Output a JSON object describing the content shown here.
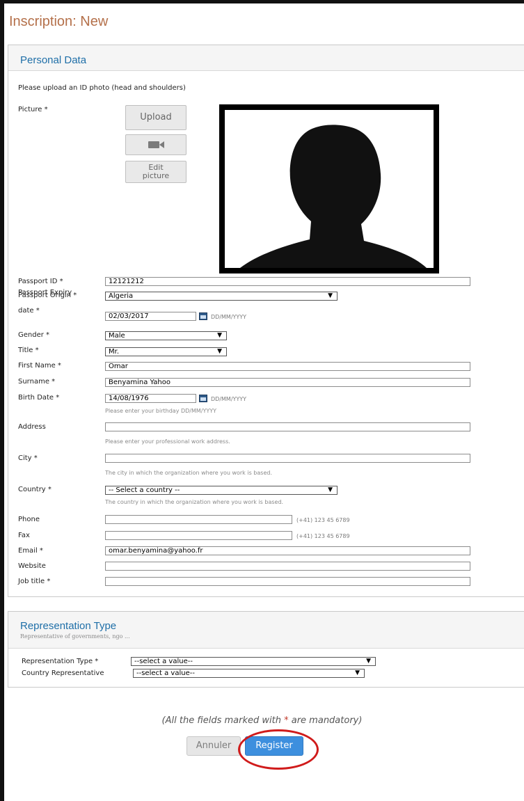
{
  "page": {
    "title": "Inscription: New"
  },
  "personal": {
    "section_title": "Personal Data",
    "photo_instruction": "Please upload an ID photo (head and shoulders)",
    "picture_label": "Picture *",
    "upload_label": "Upload",
    "edit_picture_label_1": "Edit",
    "edit_picture_label_2": "picture",
    "fields": {
      "passport_id": {
        "label": "Passport ID *",
        "value": "12121212"
      },
      "passport_origin": {
        "label": "Passport Origin *",
        "value": "Algeria"
      },
      "passport_expiry": {
        "label_1": "Passport Expiry",
        "label_2": "date *",
        "value": "02/03/2017",
        "format": "DD/MM/YYYY"
      },
      "gender": {
        "label": "Gender *",
        "value": "Male"
      },
      "title": {
        "label": "Title *",
        "value": "Mr."
      },
      "first_name": {
        "label": "First Name *",
        "value": "Omar"
      },
      "surname": {
        "label": "Surname *",
        "value": "Benyamina Yahoo"
      },
      "birth_date": {
        "label": "Birth Date *",
        "value": "14/08/1976",
        "format": "DD/MM/YYYY",
        "hint": "Please enter your birthday DD/MM/YYYY"
      },
      "address": {
        "label": "Address",
        "value": "",
        "hint": "Please enter your professional work address."
      },
      "city": {
        "label": "City *",
        "value": "",
        "hint": "The city in which the organization where you work is based."
      },
      "country": {
        "label": "Country *",
        "value": "-- Select a country --",
        "hint": "The country in which the organization where you work is based."
      },
      "phone": {
        "label": "Phone",
        "value": "",
        "example": "(+41) 123 45 6789"
      },
      "fax": {
        "label": "Fax",
        "value": "",
        "example": "(+41) 123 45 6789"
      },
      "email": {
        "label": "Email *",
        "value": "omar.benyamina@yahoo.fr"
      },
      "website": {
        "label": "Website",
        "value": ""
      },
      "job_title": {
        "label": "Job title *",
        "value": ""
      }
    }
  },
  "representation": {
    "section_title": "Representation Type",
    "subtitle": "Representative of governments, ngo ...",
    "type": {
      "label": "Representation Type *",
      "value": "--select a value--"
    },
    "country_rep": {
      "label": "Country Representative",
      "value": "--select a value--"
    }
  },
  "footer": {
    "note_before": "(All the fields marked with ",
    "note_star": "*",
    "note_after": " are mandatory)",
    "cancel_label": "Annuler",
    "register_label": "Register"
  },
  "colors": {
    "accent": "#3d8fde",
    "title": "#b4704a",
    "section_title": "#1f6fa8",
    "highlight": "#d01b1b"
  },
  "icons": {
    "camera": "video-camera-icon",
    "calendar": "calendar-icon",
    "dropdown": "dropdown-arrow-icon"
  }
}
